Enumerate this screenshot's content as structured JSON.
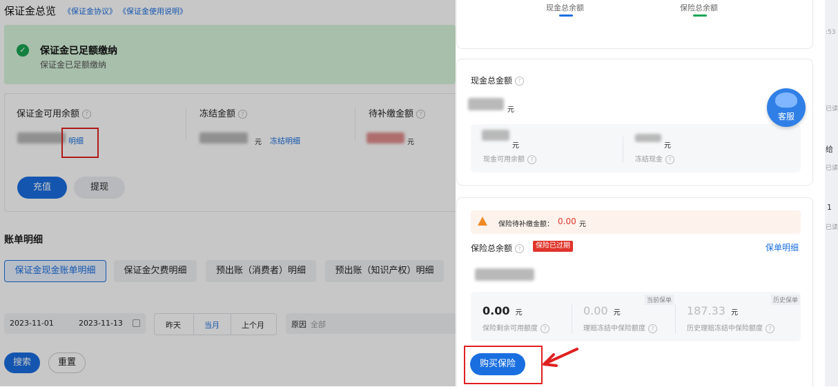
{
  "header": {
    "title": "保证金总览",
    "link1": "《保证金协议》",
    "link2": "《保证金使用说明》"
  },
  "alert": {
    "title": "保证金已足额缴纳",
    "subtitle": "保证金已足额缴纳"
  },
  "balances": {
    "available_label": "保证金可用余额",
    "detail_link": "明细",
    "frozen_label": "冻结金额",
    "frozen_unit": "元",
    "frozen_link": "冻结明细",
    "pending_label": "待补缴金额",
    "pending_unit": "元",
    "recharge": "充值",
    "withdraw": "提现"
  },
  "bill": {
    "title": "账单明细",
    "tabs": [
      "保证金现金账单明细",
      "保证金欠费明细",
      "预出账（消费者）明细",
      "预出账（知识产权）明细"
    ],
    "date_start": "2023-11-01",
    "date_end": "2023-11-13",
    "quick": [
      "昨天",
      "当月",
      "上个月"
    ],
    "reason_label": "原因",
    "reason_value": "全部",
    "search": "搜索",
    "reset": "重置"
  },
  "panel": {
    "tab_cash": "现金总余额",
    "tab_insurance": "保险总余额",
    "cash": {
      "title": "现金总金额",
      "total_unit": "元",
      "available_unit": "元",
      "available_label": "现金可用余额",
      "frozen_unit": "元",
      "frozen_label": "冻结现金"
    },
    "service": "客服",
    "insurance": {
      "warning_label": "保险待补缴金额：",
      "warning_amount": "0.00",
      "warning_unit": "元",
      "title": "保险总余额",
      "badge": "保险已过期",
      "policy_link": "保单明细",
      "current_tag": "当前保单",
      "history_tag": "历史保单",
      "stats": [
        {
          "value": "0.00",
          "unit": "元",
          "label": "保险剩余可用额度"
        },
        {
          "value": "0.00",
          "unit": "元",
          "label": "理赔冻结中保险额度"
        },
        {
          "value": "187.33",
          "unit": "元",
          "label": "历史理赔冻结中保险额度"
        }
      ],
      "buy": "购买保险"
    }
  },
  "edge": {
    "time": ":53",
    "read1": "已读",
    "msg": "给",
    "read2": "已读",
    "num": "1",
    "read3": "已读"
  },
  "colors": {
    "primary": "#1a6fe0",
    "success": "#1aa551",
    "danger": "#e0342b",
    "annotation": "#e02020"
  }
}
